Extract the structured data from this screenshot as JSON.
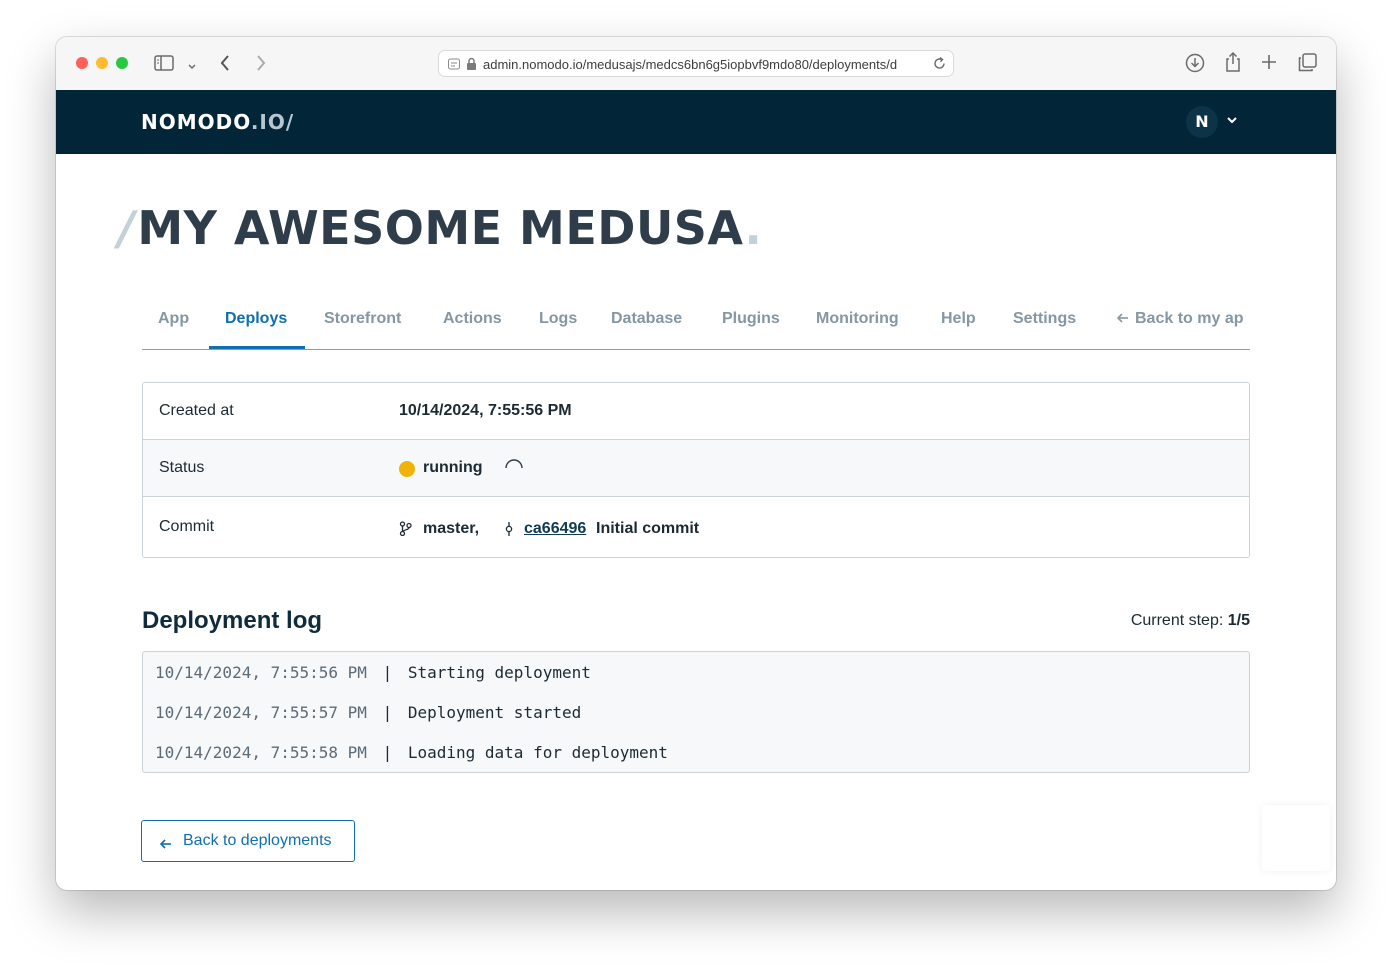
{
  "browser": {
    "url": "admin.nomodo.io/medusajs/medcs6bn6g5iopbvf9mdo80/deployments/d"
  },
  "header": {
    "logo_main": "NOMODO",
    "logo_ext": ".IO/",
    "avatar_initial": "N"
  },
  "page": {
    "title": "MY AWESOME MEDUSA",
    "title_slash": "/",
    "title_dot": "."
  },
  "tabs": [
    {
      "label": "App"
    },
    {
      "label": "Deploys",
      "active": true
    },
    {
      "label": "Storefront"
    },
    {
      "label": "Actions"
    },
    {
      "label": "Logs"
    },
    {
      "label": "Database"
    },
    {
      "label": "Plugins"
    },
    {
      "label": "Monitoring"
    },
    {
      "label": "Help"
    },
    {
      "label": "Settings"
    },
    {
      "label": "Back to my ap"
    }
  ],
  "details": {
    "created_label": "Created at",
    "created_value": "10/14/2024, 7:55:56 PM",
    "status_label": "Status",
    "status_value": "running",
    "status_color": "#f0b30b",
    "commit_label": "Commit",
    "commit_branch": "master,",
    "commit_hash": "ca66496",
    "commit_message": "Initial commit"
  },
  "log": {
    "title": "Deployment log",
    "step_label": "Current step:",
    "step_value": "1/5",
    "lines": [
      {
        "time": "10/14/2024, 7:55:56 PM",
        "sep": "|",
        "message": "Starting deployment"
      },
      {
        "time": "10/14/2024, 7:55:57 PM",
        "sep": "|",
        "message": "Deployment started"
      },
      {
        "time": "10/14/2024, 7:55:58 PM",
        "sep": "|",
        "message": "Loading data for deployment"
      }
    ]
  },
  "actions": {
    "back_label": "Back to deployments"
  },
  "colors": {
    "navbar": "#022538",
    "accent": "#0f6fb0",
    "title": "#2e3d49"
  }
}
